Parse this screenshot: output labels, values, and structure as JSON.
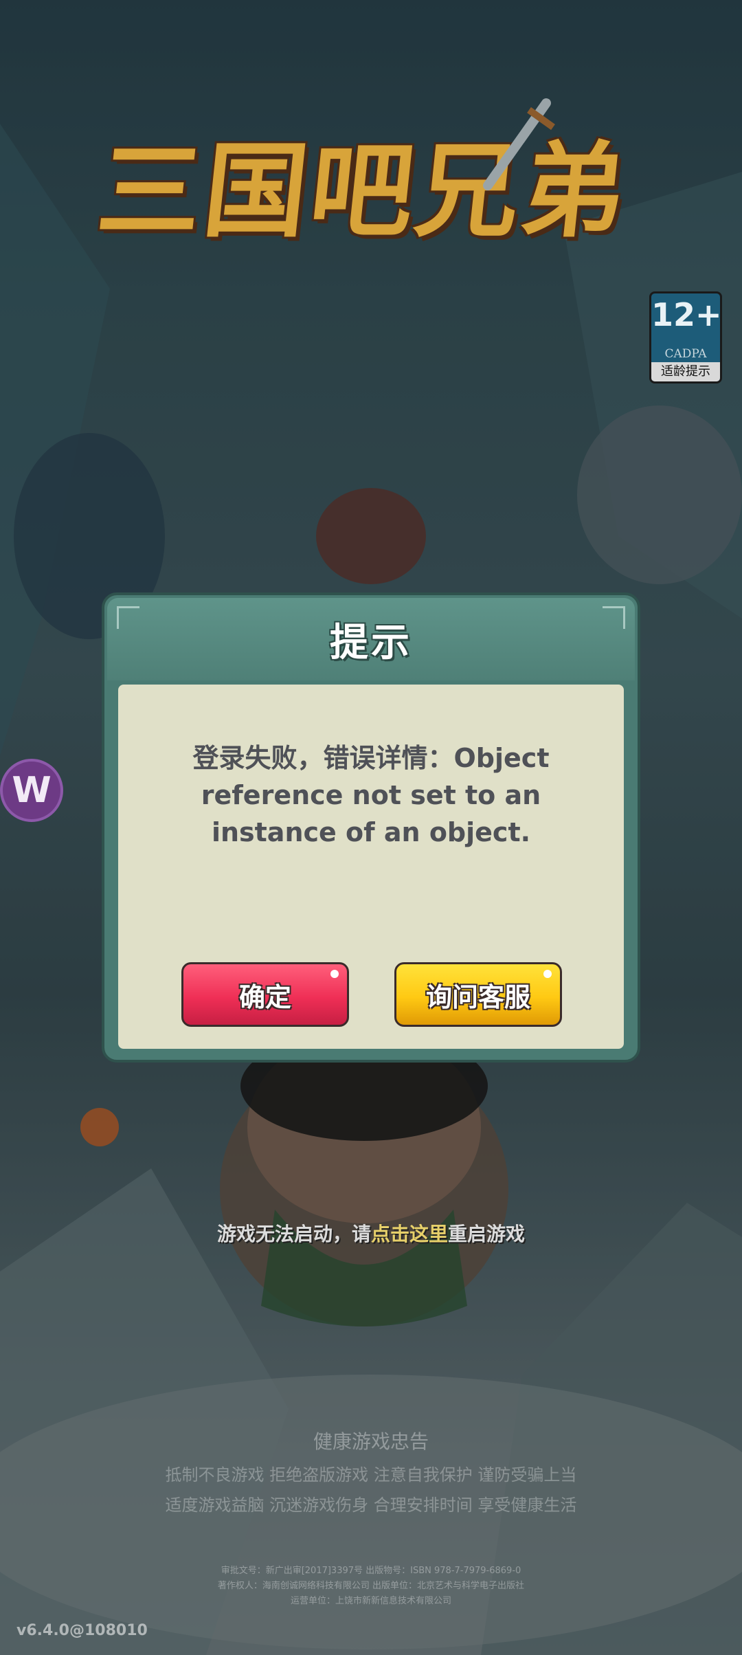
{
  "game": {
    "logo_text": "三国吧兄弟"
  },
  "age_rating": {
    "number": "12+",
    "org": "CADPA",
    "label": "适龄提示"
  },
  "side_widget": {
    "letter": "W"
  },
  "dialog": {
    "title": "提示",
    "message": "登录失败，错误详情：Object reference not set to an instance of an object.",
    "confirm_label": "确定",
    "support_label": "询问客服"
  },
  "restart_notice": {
    "prefix": "游戏无法启动，请",
    "link": "点击这里",
    "suffix": "重启游戏"
  },
  "health_notice": {
    "title": "健康游戏忠告",
    "lines": [
      "抵制不良游戏  拒绝盗版游戏  注意自我保护  谨防受骗上当",
      "适度游戏益脑  沉迷游戏伤身  合理安排时间  享受健康生活"
    ]
  },
  "publisher_info": {
    "lines": [
      "审批文号：新广出审[2017]3397号   出版物号：ISBN 978-7-7979-6869-0",
      "著作权人：海南创诚网络科技有限公司   出版单位：北京艺术与科学电子出版社",
      "运营单位：上饶市新新信息技术有限公司"
    ]
  },
  "version": "v6.4.0@108010",
  "colors": {
    "dialog_frame": "#4a7b73",
    "dialog_body": "#e0e0c8",
    "confirm_button": "#ef2f56",
    "support_button": "#ffc913",
    "link_highlight": "#e7d06a"
  }
}
